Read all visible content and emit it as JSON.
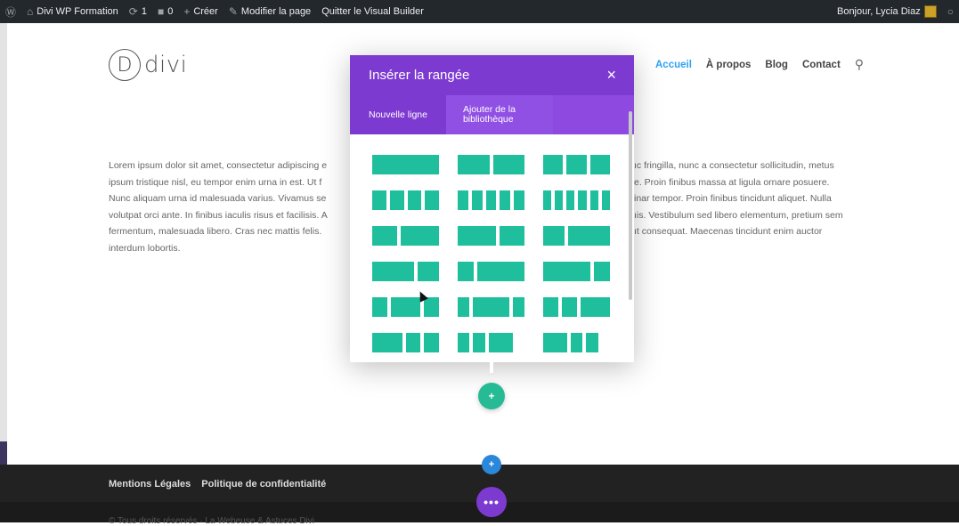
{
  "adminbar": {
    "site_name": "Divi WP Formation",
    "updates_count": "1",
    "comments_count": "0",
    "create_label": "Créer",
    "edit_page_label": "Modifier la page",
    "exit_builder_label": "Quitter le Visual Builder",
    "greeting": "Bonjour, Lycia Diaz"
  },
  "header": {
    "logo_letter": "D",
    "logo_text": "divi",
    "nav": [
      "Accueil",
      "À propos",
      "Blog",
      "Contact"
    ]
  },
  "content": {
    "left_lines": [
      "Lorem ipsum dolor sit amet, consectetur adipiscing e",
      "ipsum tristique nisl, eu tempor enim urna in est. Ut f",
      "Nunc aliquam urna id malesuada varius. Vivamus se",
      "volutpat orci ante. In finibus iaculis risus et facilisis. A",
      "fermentum, malesuada libero. Cras nec mattis felis.",
      "interdum lobortis."
    ],
    "right_lines": [
      "ıc fringilla, nunc a consectetur sollicitudin, metus",
      "e. Proin finibus massa at ligula ornare posuere.",
      "inar tempor. Proin finibus tincidunt aliquet. Nulla",
      "ıis. Vestibulum sed libero elementum, pretium sem",
      "ıt consequat. Maecenas tincidunt enim auctor"
    ]
  },
  "modal": {
    "title": "Insérer la rangée",
    "close": "×",
    "tabs": [
      "Nouvelle ligne",
      "Ajouter de la bibliothèque"
    ],
    "layouts": [
      "1",
      "1/2,1/2",
      "1/3,1/3,1/3",
      "1/4,1/4,1/4,1/4",
      "1/5x5",
      "1/6x6",
      "2/5,3/5",
      "3/5,2/5",
      "1/3,2/3",
      "2/3,1/3",
      "1/4,3/4",
      "3/4,1/4",
      "1/4,1/2,1/4",
      "1/5,3/5,1/5",
      "1/4,1/4,1/2",
      "1/2,1/4,1/4",
      "1/5,1/5,2/5",
      "2/5,1/5,1/5"
    ]
  },
  "buttons": {
    "add_row": "+",
    "add_section": "+",
    "page_settings": "•••"
  },
  "footer": {
    "links": [
      "Mentions Légales",
      "Politique de confidentialité"
    ],
    "copyright": "© Tous droits réservés · La Webeuse & Astuces Divi"
  },
  "colors": {
    "purple": "#7d3ad1",
    "teal": "#1fbf9e",
    "green_button": "#26bb94",
    "blue_button": "#2b87da",
    "nav_active": "#2ea3f2"
  }
}
